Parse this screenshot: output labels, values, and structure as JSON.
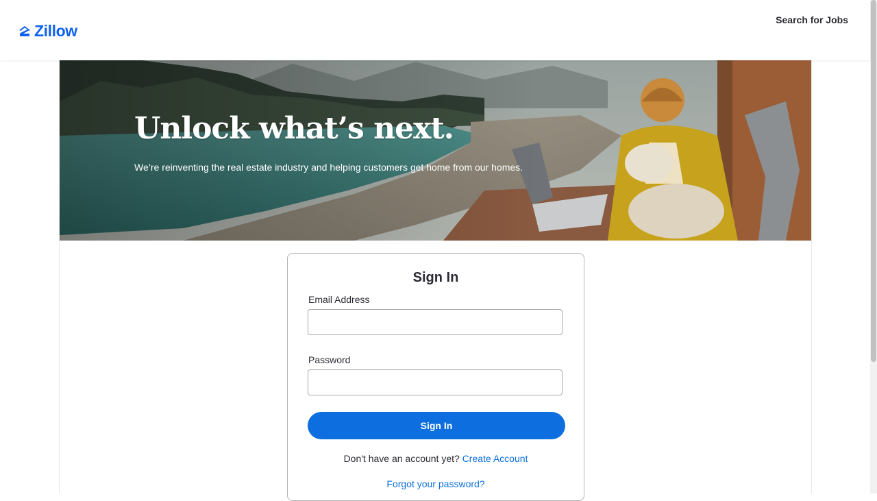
{
  "header": {
    "logo_text": "Zillow",
    "jobs_link": "Search for Jobs"
  },
  "hero": {
    "title": "Unlock what’s next.",
    "subtitle": "We’re reinventing the real estate industry and helping customers get home from our homes."
  },
  "signin": {
    "heading": "Sign In",
    "email_label": "Email Address",
    "email_value": "",
    "password_label": "Password",
    "password_value": "",
    "submit_label": "Sign In",
    "no_account_text": "Don't have an account yet?",
    "create_account_link": "Create Account",
    "forgot_link": "Forgot your password?"
  },
  "colors": {
    "brand_blue": "#1062ee",
    "button_blue": "#0d6fdf",
    "text_dark": "#2a2a33"
  },
  "icons": [
    "zillow-logo-mark-icon"
  ]
}
